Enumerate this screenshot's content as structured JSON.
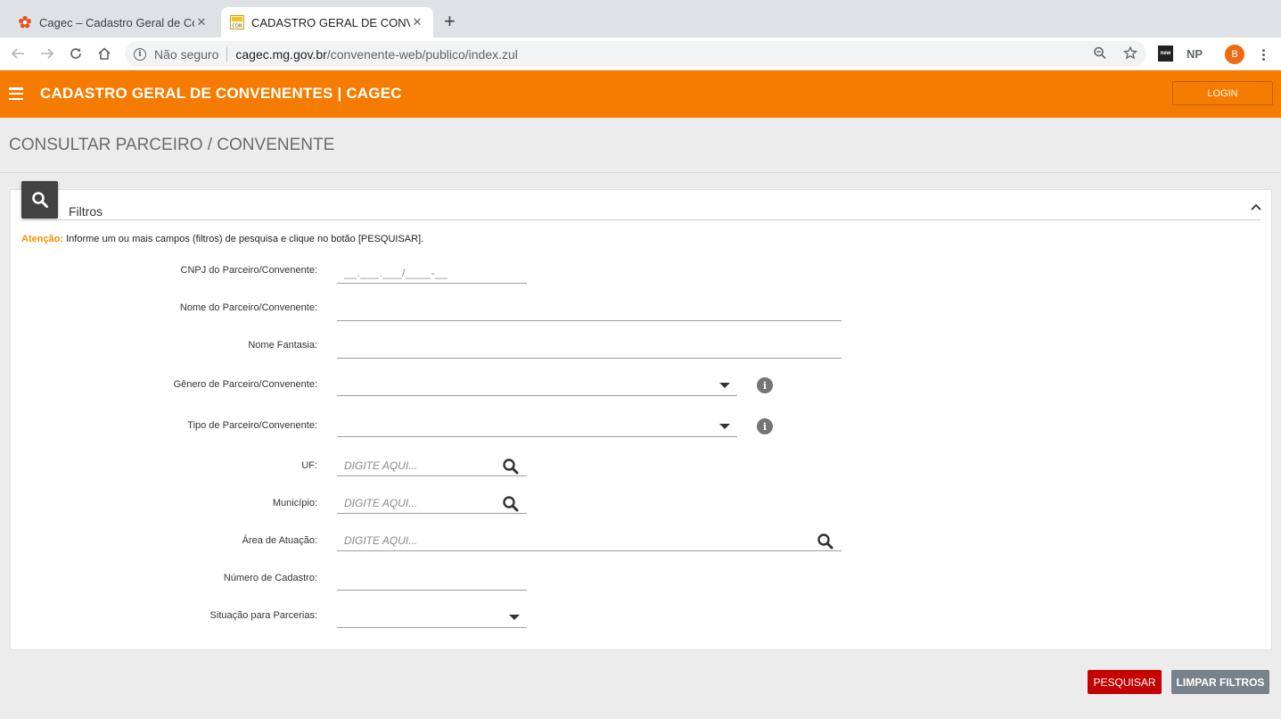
{
  "browser": {
    "tabs": [
      {
        "title": "Cagec – Cadastro Geral de Convenentes",
        "active": false,
        "favicon": "flower-icon"
      },
      {
        "title": "CADASTRO GERAL DE CONVENENTES",
        "active": true,
        "favicon": "con-icon"
      }
    ],
    "favicon_con_text": "CON",
    "address": {
      "security": "Não seguro",
      "host": "cagec.mg.gov.br",
      "path": "/convenente-web/publico/index.zul"
    },
    "ext_new_text": "new",
    "ext_np_text": "NP",
    "avatar_letter": "B"
  },
  "header": {
    "title": "CADASTRO GERAL DE CONVENENTES | CAGEC",
    "login_label": "LOGIN",
    "color": "#f57c00"
  },
  "page_title": "CONSULTAR PARCEIRO / CONVENENTE",
  "filters": {
    "title": "Filtros",
    "attention_label": "Atenção:",
    "attention_text": " Informe um ou mais campos (filtros) de pesquisa e clique no botão [PESQUISAR].",
    "fields": {
      "cnpj": {
        "label": "CNPJ do Parceiro/Convenente:",
        "mask": "__.___.___/____-__"
      },
      "nome": {
        "label": "Nome do Parceiro/Convenente:",
        "value": ""
      },
      "fantasia": {
        "label": "Nome Fantasia:",
        "value": ""
      },
      "genero": {
        "label": "Gênero de Parceiro/Convenente:",
        "value": ""
      },
      "tipo": {
        "label": "Tipo de Parceiro/Convenente:",
        "value": ""
      },
      "uf": {
        "label": "UF:",
        "placeholder": "DIGITE AQUI..."
      },
      "municipio": {
        "label": "Município:",
        "placeholder": "DIGITE AQUI..."
      },
      "area": {
        "label": "Área de Atuação:",
        "placeholder": "DIGITE AQUI..."
      },
      "numero": {
        "label": "Número de Cadastro:",
        "value": ""
      },
      "situacao": {
        "label": "Situação para Parcerias:",
        "value": ""
      }
    }
  },
  "buttons": {
    "search": "PESQUISAR",
    "clear": "LIMPAR FILTROS"
  }
}
